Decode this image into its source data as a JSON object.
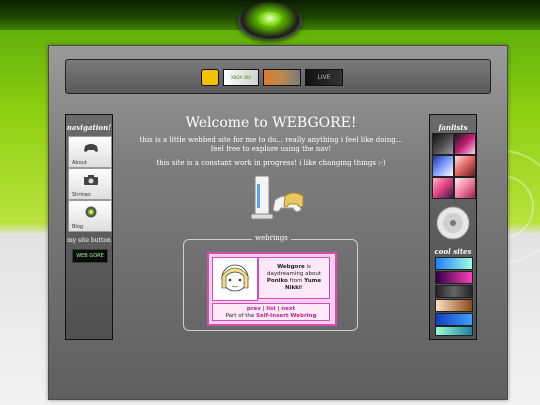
{
  "nav": {
    "title": "navigation!",
    "items": [
      {
        "label": "About",
        "icon": "gamepad-icon"
      },
      {
        "label": "Shrines",
        "icon": "camera-icon"
      },
      {
        "label": "Blog",
        "icon": "disc-icon"
      }
    ],
    "site_button_label": "my site button",
    "site_button_text": "WEB GORE"
  },
  "header_buttons": [
    {
      "name": "site-icon-button"
    },
    {
      "name": "xbox360-button",
      "text": "XBOX 360"
    },
    {
      "name": "banner-button"
    },
    {
      "name": "xbox-live-button",
      "text": "LIVE"
    }
  ],
  "main": {
    "welcome": "Welcome to WEBGORE!",
    "intro": "this is a little webbed site for me to do... really anything i feel like doing... feel free to explore using the nav!",
    "wip": "this site is a constant work in progress! i like changing things :-)"
  },
  "webrings": {
    "title": "webrings",
    "desc_site": "Webgore",
    "desc_mid1": " is daydreaming about ",
    "desc_char": "Poniko",
    "desc_mid2": " from ",
    "desc_game": "Yume Nikki",
    "desc_end": "!",
    "prev": "prev",
    "list": "list",
    "next": "next",
    "sep": " | ",
    "part_of": "Part of the ",
    "ring_name": "Self-Insert Webring"
  },
  "right": {
    "fanlists_title": "fanlists",
    "cool_sites_title": "cool sites"
  },
  "colors": {
    "accent_green": "#8fd012",
    "ring_pink": "#d64cb5"
  }
}
